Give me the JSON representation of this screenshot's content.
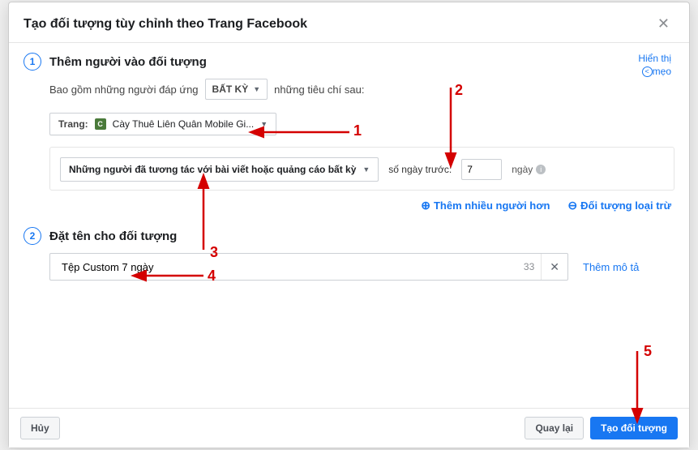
{
  "modal": {
    "title": "Tạo đối tượng tùy chỉnh theo Trang Facebook",
    "tip": {
      "line1": "Hiển thị",
      "line2": "mẹo"
    }
  },
  "step1": {
    "num": "1",
    "title": "Thêm người vào đối tượng",
    "criteria_prefix": "Bao gồm những người đáp ứng",
    "criteria_dd": "BẤT KỲ",
    "criteria_suffix": "những tiêu chí sau:",
    "page_label": "Trang:",
    "page_icon": "C",
    "page_name": "Cày Thuê Liên Quân Mobile Gi...",
    "engage_dd": "Những người đã tương tác với bài viết hoặc quảng cáo bất kỳ",
    "days_label": "số ngày trước:",
    "days_value": "7",
    "days_unit": "ngày",
    "action_include": "Thêm nhiều người hơn",
    "action_exclude": "Đối tượng loại trừ"
  },
  "step2": {
    "num": "2",
    "title": "Đặt tên cho đối tượng",
    "name_value": "Tệp Custom 7 ngày",
    "char_count": "33",
    "add_desc": "Thêm mô tả"
  },
  "footer": {
    "cancel": "Hủy",
    "back": "Quay lại",
    "create": "Tạo đối tượng"
  },
  "annotations": {
    "n1": "1",
    "n2": "2",
    "n3": "3",
    "n4": "4",
    "n5": "5"
  }
}
